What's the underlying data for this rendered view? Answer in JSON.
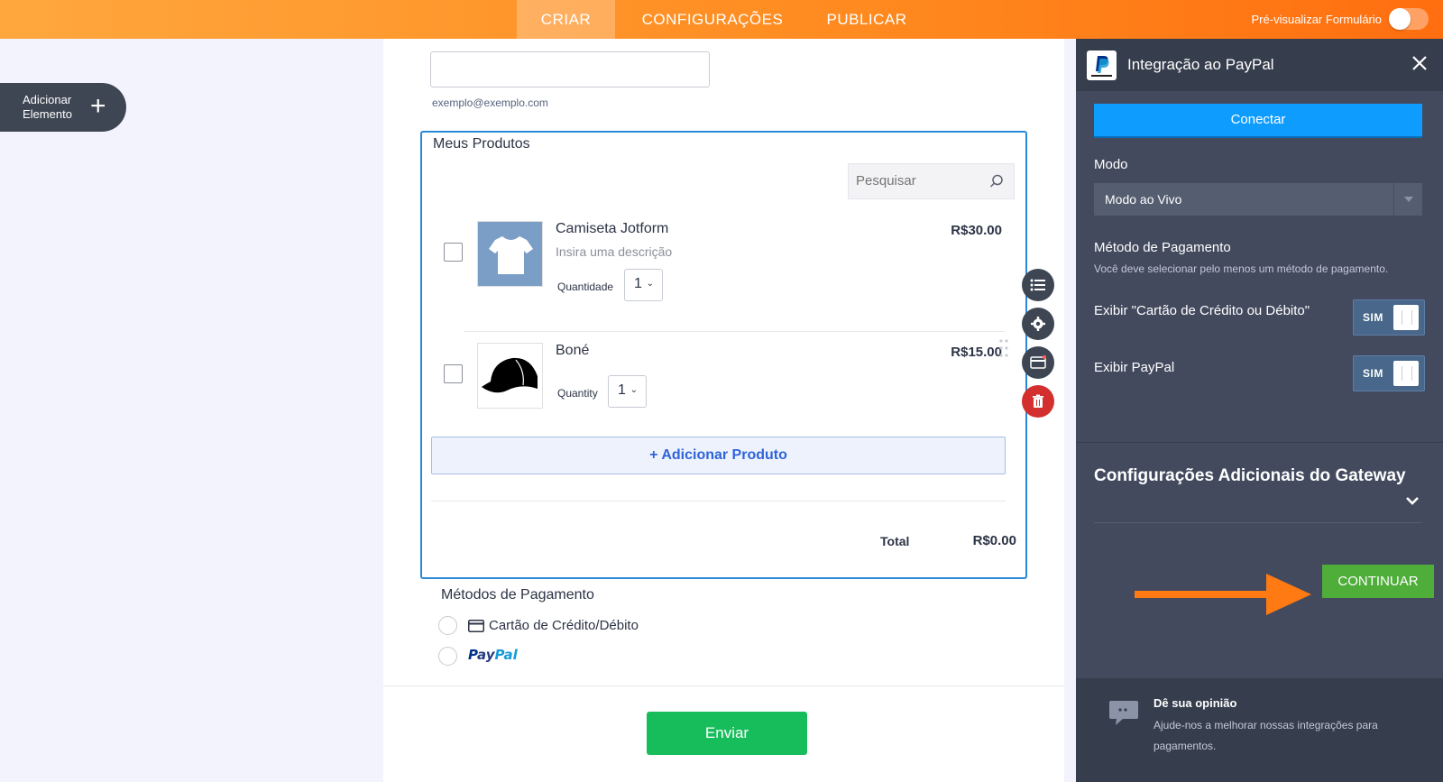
{
  "topbar": {
    "tabs": [
      {
        "label": "CRIAR",
        "active": true
      },
      {
        "label": "CONFIGURAÇÕES",
        "active": false
      },
      {
        "label": "PUBLICAR",
        "active": false
      }
    ],
    "preview_label": "Pré-visualizar Formulário",
    "preview_enabled": false,
    "gradient_start": "#ffa73d",
    "gradient_end": "#ff6e10"
  },
  "add_element": {
    "label": "Adicionar Elemento",
    "icon": "plus-icon"
  },
  "form": {
    "email_sublabel": "exemplo@exemplo.com",
    "products_widget": {
      "title": "Meus Produtos",
      "search_placeholder": "Pesquisar",
      "products": [
        {
          "name": "Camiseta Jotform",
          "description": "Insira uma descrição",
          "price": "R$30.00",
          "quantity_label": "Quantidade",
          "quantity": "1",
          "image": "tshirt-image"
        },
        {
          "name": "Boné",
          "price": "R$15.00",
          "quantity_label": "Quantity",
          "quantity": "1",
          "image": "cap-image"
        }
      ],
      "add_product_label": "+ Adicionar Produto",
      "total_label": "Total",
      "total_value": "R$0.00"
    },
    "payment_methods": {
      "title": "Métodos de Pagamento",
      "options": [
        {
          "label": "Cartão de Crédito/Débito",
          "icon": "credit-card-icon"
        },
        {
          "label": "PayPal",
          "icon": "paypal-logo"
        }
      ]
    },
    "submit_label": "Enviar",
    "submit_color": "#18bd5b"
  },
  "panel": {
    "title": "Integração ao PayPal",
    "connect_label": "Conectar",
    "mode_label": "Modo",
    "mode_value": "Modo ao Vivo",
    "payment_method_label": "Método de Pagamento",
    "payment_method_help": "Você deve selecionar pelo menos um método de pagamento.",
    "show_card_label": "Exibir \"Cartão de Crédito ou Débito\"",
    "show_card_value": "SIM",
    "show_paypal_label": "Exibir PayPal",
    "show_paypal_value": "SIM",
    "gateway_title": "Configurações Adicionais do Gateway",
    "continue_label": "CONTINUAR",
    "feedback_title": "Dê sua opinião",
    "feedback_text": "Ajude-nos a melhorar nossas integrações para pagamentos.",
    "accent": "#0e9cff",
    "continue_color": "#4fad3a",
    "annotation_arrow_color": "#ff7a12"
  }
}
